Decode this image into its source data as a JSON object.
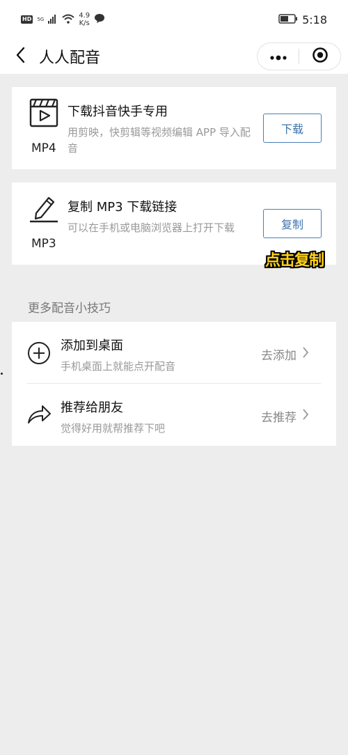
{
  "status_bar": {
    "hd_label": "HD",
    "signal_label": "5G",
    "speed_value": "4.9",
    "speed_unit": "K/s",
    "time": "5:18"
  },
  "nav": {
    "title": "人人配音"
  },
  "cards": [
    {
      "icon": "clapperboard-icon",
      "format": "MP4",
      "title": "下载抖音快手专用",
      "description": "用剪映，快剪辑等视频编辑 APP 导入配音",
      "button": "下载"
    },
    {
      "icon": "pencil-icon",
      "format": "MP3",
      "title": "复制 MP3 下载链接",
      "description": "可以在手机或电脑浏览器上打开下载",
      "button": "复制"
    }
  ],
  "sticker_text": "点击复制",
  "section_title": "更多配音小技巧",
  "tips": [
    {
      "icon": "plus-circle-icon",
      "title": "添加到桌面",
      "description": "手机桌面上就能点开配音",
      "action": "去添加"
    },
    {
      "icon": "share-arrow-icon",
      "title": "推荐给朋友",
      "description": "觉得好用就帮推荐下吧",
      "action": "去推荐"
    }
  ],
  "colors": {
    "accent": "#3f73ab",
    "background": "#ededed",
    "sticker": "#ffd21a"
  }
}
